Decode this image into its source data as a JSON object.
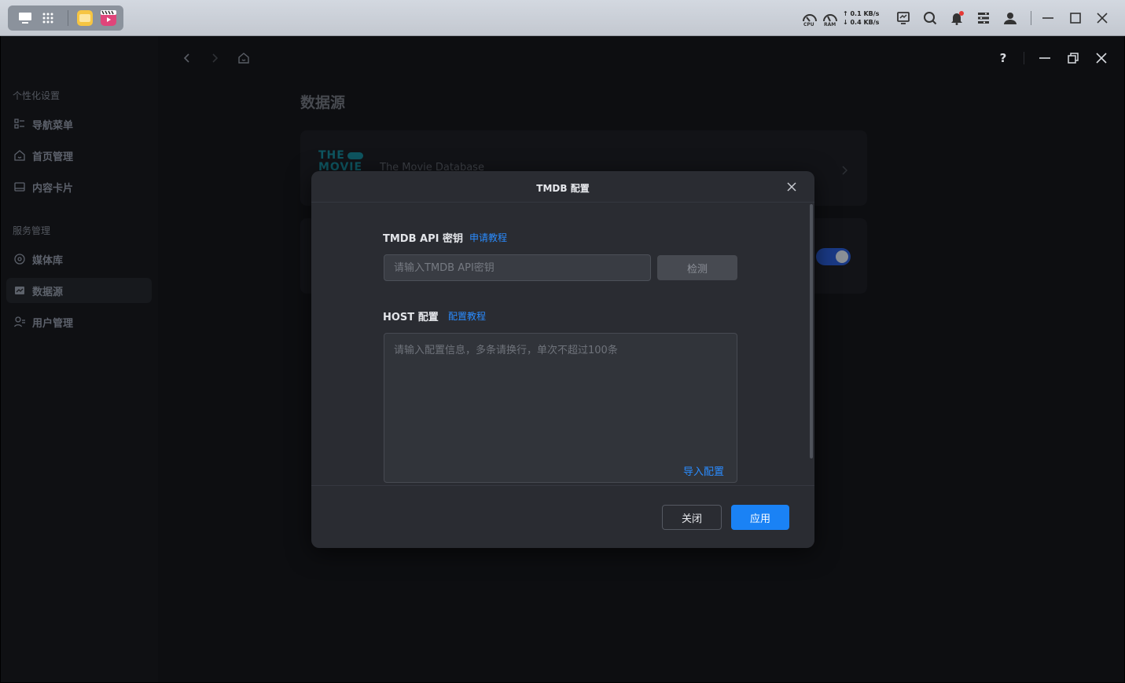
{
  "taskbar": {
    "cpu_label": "CPU",
    "ram_label": "RAM",
    "upload_speed": "↑ 0.1 KB/s",
    "download_speed": "↓ 0.4 KB/s"
  },
  "sidebar": {
    "sections": [
      {
        "title": "个性化设置",
        "items": [
          {
            "label": "导航菜单",
            "icon": "list-icon"
          },
          {
            "label": "首页管理",
            "icon": "home-icon"
          },
          {
            "label": "内容卡片",
            "icon": "card-icon"
          }
        ]
      },
      {
        "title": "服务管理",
        "items": [
          {
            "label": "媒体库",
            "icon": "media-icon"
          },
          {
            "label": "数据源",
            "icon": "datasource-icon",
            "active": true
          },
          {
            "label": "用户管理",
            "icon": "users-icon"
          }
        ]
      }
    ]
  },
  "main": {
    "page_title": "数据源",
    "tmdb_card": {
      "logo_line1": "THE",
      "logo_line2": "MOVIE",
      "description": "The Movie Database"
    }
  },
  "modal": {
    "title": "TMDB 配置",
    "api_key_label": "TMDB API 密钥",
    "api_key_link": "申请教程",
    "api_key_placeholder": "请输入TMDB API密钥",
    "api_key_value": "",
    "detect_button": "检测",
    "host_label": "HOST 配置",
    "host_link": "配置教程",
    "host_placeholder": "请输入配置信息，多条请换行，单次不超过100条",
    "host_value": "",
    "import_link": "导入配置",
    "close_button": "关闭",
    "apply_button": "应用"
  },
  "colors": {
    "accent": "#1a82f5",
    "link": "#2a8cff",
    "toggle_on": "#1a3a86"
  }
}
